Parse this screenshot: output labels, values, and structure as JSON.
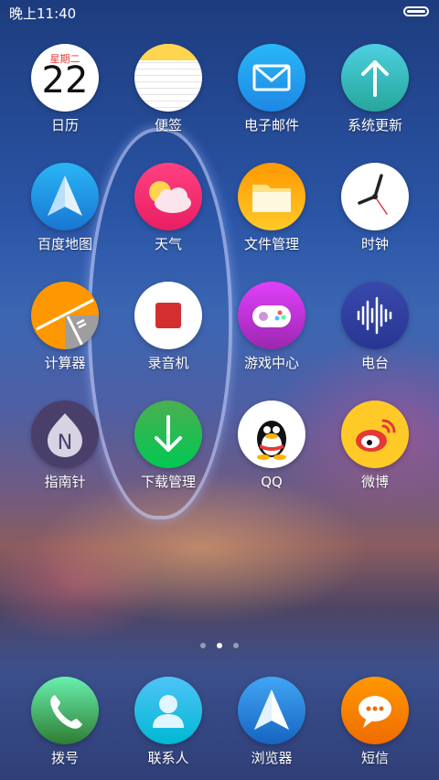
{
  "status_bar": {
    "time": "晚上11:40"
  },
  "calendar": {
    "weekday": "星期二",
    "day": "22"
  },
  "apps": [
    {
      "label": "日历",
      "icon": "calendar-icon"
    },
    {
      "label": "便签",
      "icon": "notes-icon"
    },
    {
      "label": "电子邮件",
      "icon": "mail-icon"
    },
    {
      "label": "系统更新",
      "icon": "update-icon"
    },
    {
      "label": "百度地图",
      "icon": "map-icon"
    },
    {
      "label": "天气",
      "icon": "weather-icon"
    },
    {
      "label": "文件管理",
      "icon": "folder-icon"
    },
    {
      "label": "时钟",
      "icon": "clock-icon"
    },
    {
      "label": "计算器",
      "icon": "calculator-icon"
    },
    {
      "label": "录音机",
      "icon": "recorder-icon"
    },
    {
      "label": "游戏中心",
      "icon": "gamepad-icon"
    },
    {
      "label": "电台",
      "icon": "radio-icon"
    },
    {
      "label": "指南针",
      "icon": "compass-icon"
    },
    {
      "label": "下载管理",
      "icon": "download-icon"
    },
    {
      "label": "QQ",
      "icon": "qq-icon"
    },
    {
      "label": "微博",
      "icon": "weibo-icon"
    }
  ],
  "dock": [
    {
      "label": "拨号",
      "icon": "phone-icon"
    },
    {
      "label": "联系人",
      "icon": "contacts-icon"
    },
    {
      "label": "浏览器",
      "icon": "browser-icon"
    },
    {
      "label": "短信",
      "icon": "message-icon"
    }
  ],
  "page_indicator": {
    "pages": 3,
    "active": 2
  }
}
